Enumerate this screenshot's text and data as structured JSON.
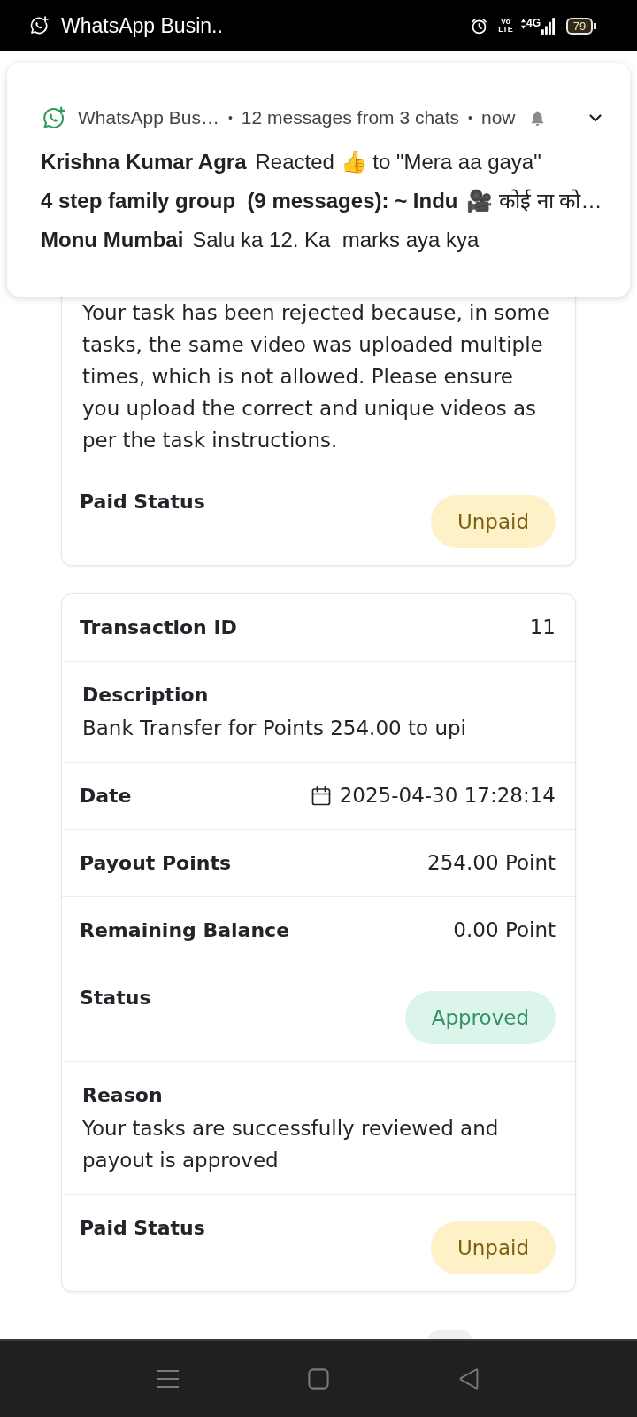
{
  "status_bar": {
    "app_title": "WhatsApp Busin..",
    "volte": "Vo LTE",
    "network": "4G",
    "battery": "79"
  },
  "notification": {
    "expanded": false,
    "header_items": [
      {
        "kind": "app",
        "text": "WhatsApp Bus…"
      },
      {
        "kind": "separator",
        "text": "•"
      },
      {
        "kind": "summary",
        "text": "12 messages from 3 chats"
      },
      {
        "kind": "separator",
        "text": "•"
      },
      {
        "kind": "time",
        "text": "now"
      }
    ],
    "messages": [
      {
        "sender": "Krishna Kumar Agra",
        "text": "Reacted 👍 to \"Mera aa gaya\""
      },
      {
        "sender": "4 step family group  (9 messages): ~ Indu",
        "text": "🎥 कोई ना को…"
      },
      {
        "sender": "Monu Mumbai",
        "text": "Salu ka 12. Ka  marks aya kya"
      }
    ]
  },
  "cards": [
    {
      "fields": [
        {
          "kind": "note",
          "value": "Your task has been rejected because, in some tasks, the same video was uploaded multiple times, which is not allowed. Please ensure you upload the correct and unique videos as per the task instructions."
        },
        {
          "kind": "badge",
          "label": "Paid Status",
          "value": "Unpaid",
          "color": "#fef1c8"
        }
      ]
    },
    {
      "fields": [
        {
          "kind": "inline",
          "label": "Transaction ID",
          "value": "11"
        },
        {
          "kind": "stacked",
          "label": "Description",
          "value": "Bank Transfer for Points 254.00 to upi"
        },
        {
          "kind": "date",
          "label": "Date",
          "value": "2025-04-30 17:28:14"
        },
        {
          "kind": "inline",
          "label": "Payout Points",
          "value": "254.00 Point"
        },
        {
          "kind": "inline",
          "label": "Remaining Balance",
          "value": "0.00 Point"
        },
        {
          "kind": "badge",
          "label": "Status",
          "value": "Approved",
          "color": "#dcf5eb"
        },
        {
          "kind": "stacked",
          "label": "Reason",
          "value": "Your tasks are successfully reviewed and payout is approved"
        },
        {
          "kind": "badge",
          "label": "Paid Status",
          "value": "Unpaid",
          "color": "#fef1c8"
        }
      ]
    }
  ]
}
